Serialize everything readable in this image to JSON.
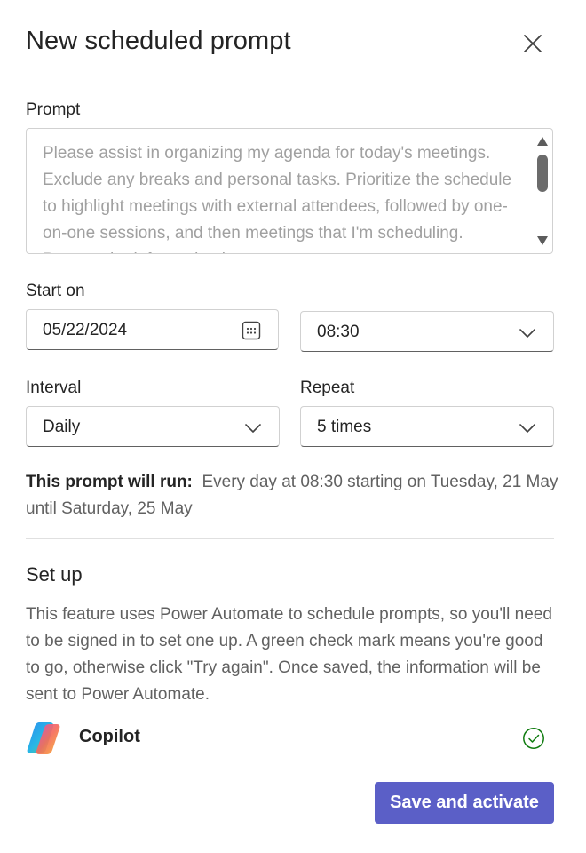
{
  "dialog": {
    "title": "New scheduled prompt"
  },
  "prompt": {
    "label": "Prompt",
    "text": "Please assist in organizing my agenda for today's meetings. Exclude any breaks and personal tasks. Prioritize the schedule to highlight meetings with external attendees, followed by one-on-one sessions, and then meetings that I'm scheduling. Present the information in a"
  },
  "start": {
    "label": "Start on",
    "date": "05/22/2024",
    "time": "08:30"
  },
  "interval": {
    "label": "Interval",
    "value": "Daily"
  },
  "repeat": {
    "label": "Repeat",
    "value": "5 times"
  },
  "summary": {
    "heading": "This prompt will run:",
    "text": "Every day at 08:30 starting on Tuesday, 21 May until Saturday, 25 May"
  },
  "setup": {
    "title": "Set up",
    "description": "This feature uses Power Automate to schedule prompts, so you'll need to be signed in to set one up. A green check mark means you're good to go, otherwise click \"Try again\". Once saved, the information will be sent to Power Automate.",
    "connection_name": "Copilot",
    "status_icon": "check-circle-icon",
    "status_color": "#107c10"
  },
  "actions": {
    "save_label": "Save and activate"
  },
  "colors": {
    "accent": "#5b5fc7"
  }
}
